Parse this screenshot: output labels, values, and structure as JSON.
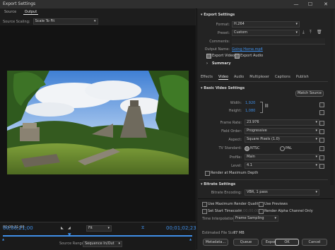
{
  "window": {
    "title": "Export Settings",
    "min": "—",
    "max": "☐",
    "close": "✕"
  },
  "source_tabs": [
    {
      "label": "Source"
    },
    {
      "label": "Output"
    }
  ],
  "source_scaling": {
    "label": "Source Scaling:",
    "value": "Scale To Fit"
  },
  "timeline": {
    "timecode_in": "00;00;21;00",
    "timecode_out": "00;01;02;23",
    "fit_value": "Fit",
    "source_range_label": "Source Range:",
    "source_range_value": "Sequence In/Out"
  },
  "export_settings": {
    "header": "Export Settings",
    "format_label": "Format:",
    "format_value": "H.264",
    "preset_label": "Preset:",
    "preset_value": "Custom",
    "comments_label": "Comments:",
    "output_name_label": "Output Name:",
    "output_name_value": "Going Home.mp4",
    "export_video_label": "Export Video",
    "export_audio_label": "Export Audio",
    "export_video_checked": true,
    "export_audio_checked": true,
    "summary_label": "Summary"
  },
  "settings_tabs": [
    {
      "label": "Effects"
    },
    {
      "label": "Video"
    },
    {
      "label": "Audio"
    },
    {
      "label": "Multiplexer"
    },
    {
      "label": "Captions"
    },
    {
      "label": "Publish"
    }
  ],
  "basic_video": {
    "header": "Basic Video Settings",
    "match_source": "Match Source",
    "width_label": "Width:",
    "width_value": "1,920",
    "height_label": "Height:",
    "height_value": "1,080",
    "frame_rate_label": "Frame Rate:",
    "frame_rate_value": "23.976",
    "field_order_label": "Field Order:",
    "field_order_value": "Progressive",
    "aspect_label": "Aspect:",
    "aspect_value": "Square Pixels (1.0)",
    "tv_standard_label": "TV Standard:",
    "ntsc_label": "NTSC",
    "pal_label": "PAL",
    "profile_label": "Profile:",
    "profile_value": "Main",
    "level_label": "Level:",
    "level_value": "4.1",
    "render_max_depth_label": "Render at Maximum Depth"
  },
  "bitrate": {
    "header": "Bitrate Settings",
    "encoding_label": "Bitrate Encoding:",
    "encoding_value": "VBR, 1 pass"
  },
  "bottom_options": {
    "max_render_quality": "Use Maximum Render Quality",
    "use_previews": "Use Previews",
    "set_start_timecode": "Set Start Timecode",
    "start_timecode_value": "00;00;00;00",
    "render_alpha": "Render Alpha Channel Only",
    "time_interp_label": "Time Interpolation:",
    "time_interp_value": "Frame Sampling",
    "file_size_label": "Estimated File Size:",
    "file_size_value": "77 MB"
  },
  "buttons": {
    "metadata": "Metadata...",
    "queue": "Queue",
    "export": "Export",
    "ok": "OK",
    "cancel": "Cancel"
  },
  "colors": {
    "accent": "#3f8fe8",
    "panel": "#232323",
    "bg": "#1d1d1d"
  }
}
